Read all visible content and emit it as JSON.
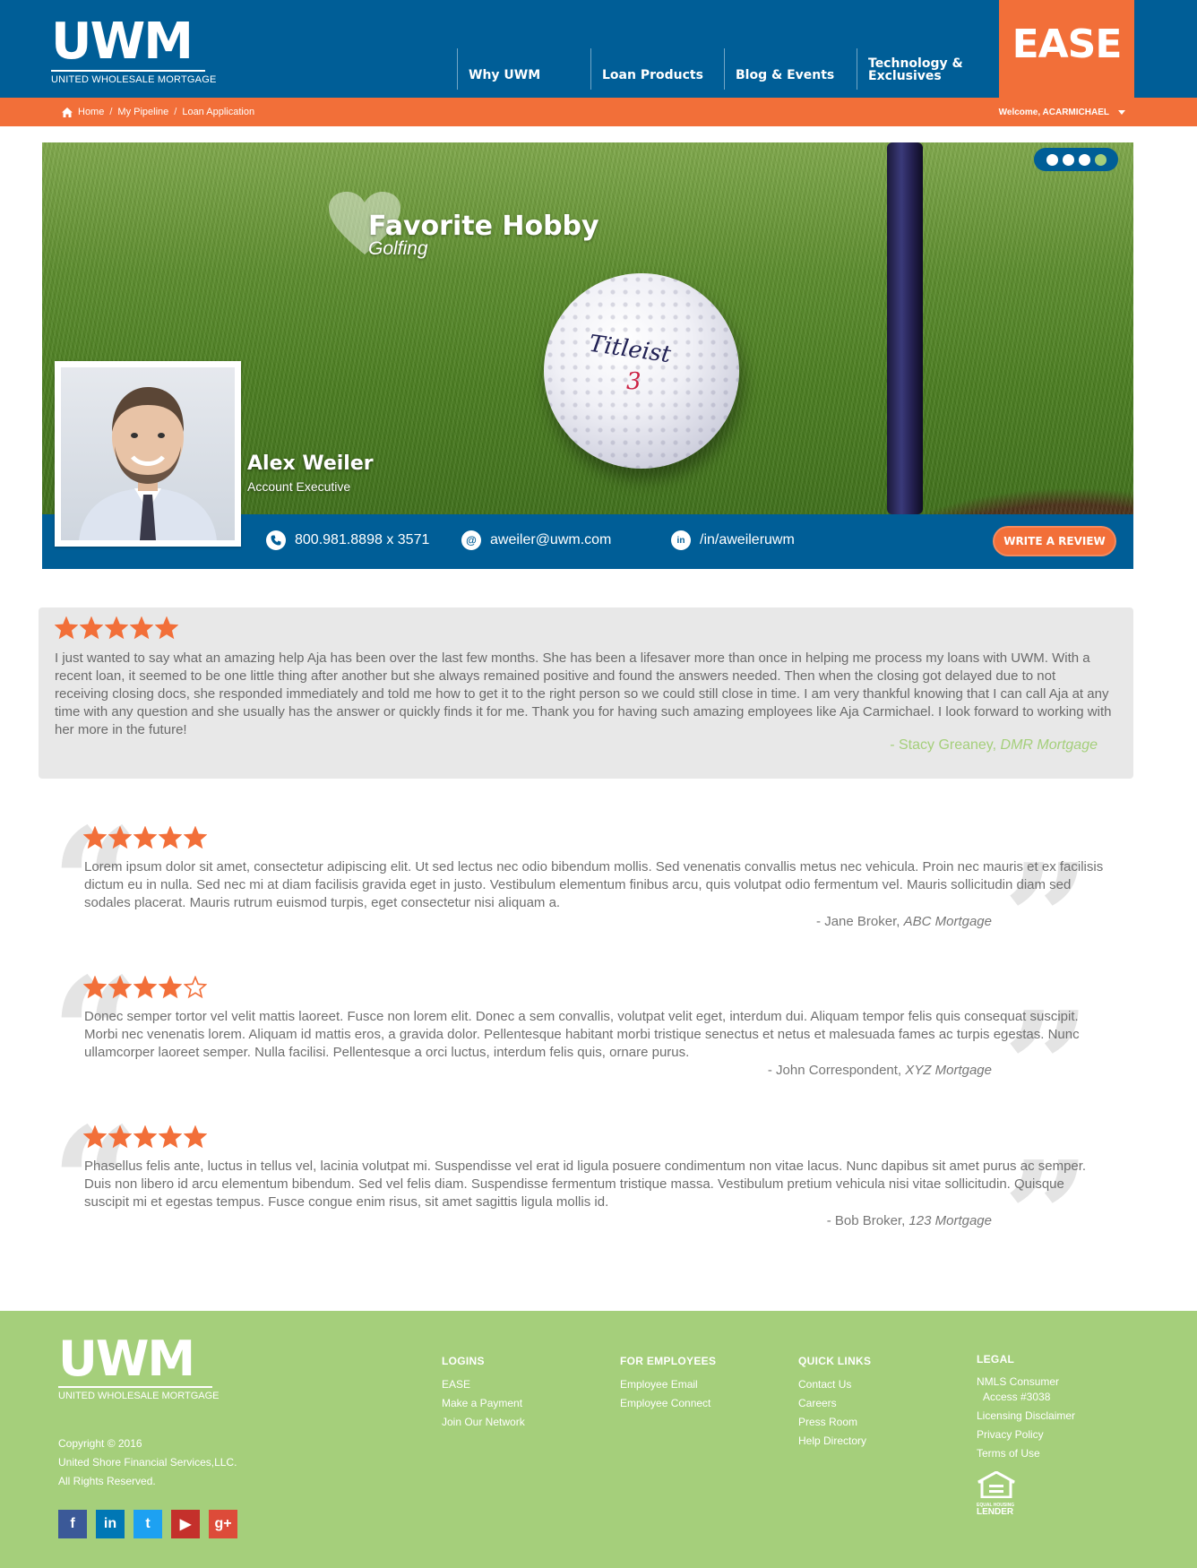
{
  "header": {
    "logo_big": "UWM",
    "logo_small": "UNITED WHOLESALE MORTGAGE",
    "nav": [
      "Why UWM",
      "Loan Products",
      "Blog & Events",
      "Technology & Exclusives"
    ],
    "ease_label": "EASE"
  },
  "breadcrumb": {
    "items": [
      "Home",
      "My Pipeline",
      "Loan Application"
    ],
    "separator": "/",
    "welcome": "Welcome, ACARMICHAEL"
  },
  "hero": {
    "hobby_title": "Favorite Hobby",
    "hobby_value": "Golfing",
    "ball_brand": "Titleist",
    "ball_number": "3",
    "slides": 4,
    "active_slide": 4
  },
  "agent": {
    "name": "Alex Weiler",
    "title": "Account Executive",
    "phone": "800.981.8898 x 3571",
    "email": "aweiler@uwm.com",
    "linkedin": "/in/aweileruwm",
    "review_button": "WRITE A REVIEW"
  },
  "featured_review": {
    "rating": 5,
    "text": "I just wanted to say what an amazing help Aja has been over the last few months. She has been a lifesaver more than once in helping me process my loans with UWM. With a recent loan, it seemed to be one little thing after another but she always remained positive and found the answers needed. Then when the closing got delayed due to not receiving closing docs, she responded immediately and told me how to get it to the right person so we could still close in time. I am very thankful knowing that I can call Aja at any time with any question and she usually has the answer or quickly finds it for me. Thank you for having such amazing employees like Aja Carmichael. I look forward to working with her more in the future!",
    "author": "- Stacy Greaney,",
    "company": "DMR Mortgage"
  },
  "reviews": [
    {
      "rating": 5,
      "text": "Lorem ipsum dolor sit amet, consectetur adipiscing elit. Ut sed lectus nec odio bibendum mollis. Sed venenatis convallis metus nec vehicula. Proin nec mauris et ex facilisis dictum eu in nulla. Sed nec mi at diam facilisis gravida eget in justo. Vestibulum elementum finibus arcu, quis volutpat odio fermentum vel. Mauris sollicitudin diam sed sodales placerat. Mauris rutrum euismod turpis, eget consectetur nisi aliquam a.",
      "author": "- Jane Broker,",
      "company": "ABC Mortgage"
    },
    {
      "rating": 4,
      "text": "Donec semper tortor vel velit mattis laoreet. Fusce non lorem elit. Donec a sem convallis, volutpat velit eget, interdum dui. Aliquam tempor felis quis consequat suscipit. Morbi nec venenatis lorem. Aliquam id mattis eros, a gravida dolor. Pellentesque habitant morbi tristique senectus et netus et malesuada fames ac turpis egestas. Nunc ullamcorper laoreet semper. Nulla facilisi. Pellentesque a orci luctus, interdum felis quis, ornare purus.",
      "author": "- John Correspondent,",
      "company": "XYZ Mortgage"
    },
    {
      "rating": 5,
      "text": "Phasellus felis ante, luctus in tellus vel, lacinia volutpat mi. Suspendisse vel erat id ligula posuere condimentum non vitae lacus. Nunc dapibus sit amet purus ac semper. Duis non libero id arcu elementum bibendum. Sed vel felis diam. Suspendisse fermentum tristique massa. Vestibulum pretium vehicula nisi vitae sollicitudin. Quisque suscipit mi et egestas tempus. Fusce congue enim risus, sit amet sagittis ligula mollis id.",
      "author": "- Bob Broker,",
      "company": "123 Mortgage"
    }
  ],
  "footer": {
    "logo_big": "UWM",
    "logo_small": "UNITED WHOLESALE MORTGAGE",
    "copyright": [
      "Copyright © 2016",
      "United Shore Financial Services,LLC.",
      "All Rights Reserved."
    ],
    "columns": [
      {
        "head": "LOGINS",
        "links": [
          "EASE",
          "Make a Payment",
          "Join Our Network"
        ]
      },
      {
        "head": "FOR EMPLOYEES",
        "links": [
          "Employee Email",
          "Employee Connect"
        ]
      },
      {
        "head": "QUICK LINKS",
        "links": [
          "Contact Us",
          "Careers",
          "Press Room",
          "Help Directory"
        ]
      },
      {
        "head": "LEGAL",
        "links": [
          "NMLS Consumer",
          "Access #3038",
          "Licensing Disclaimer",
          "Privacy Policy",
          "Terms of Use"
        ]
      }
    ],
    "equal_housing": [
      "EQUAL HOUSING",
      "LENDER"
    ],
    "socials": [
      {
        "name": "facebook-icon",
        "glyph": "f",
        "color": "#3b5998"
      },
      {
        "name": "linkedin-icon",
        "glyph": "in",
        "color": "#0077b5"
      },
      {
        "name": "twitter-icon",
        "glyph": "t",
        "color": "#1da1f2"
      },
      {
        "name": "youtube-icon",
        "glyph": "▶",
        "color": "#c4302b"
      },
      {
        "name": "google-plus-icon",
        "glyph": "g+",
        "color": "#dd4b39"
      }
    ]
  },
  "colors": {
    "brand_blue": "#005e97",
    "brand_orange": "#f26f39",
    "brand_green": "#a5cf7b",
    "star": "#f26f39"
  }
}
